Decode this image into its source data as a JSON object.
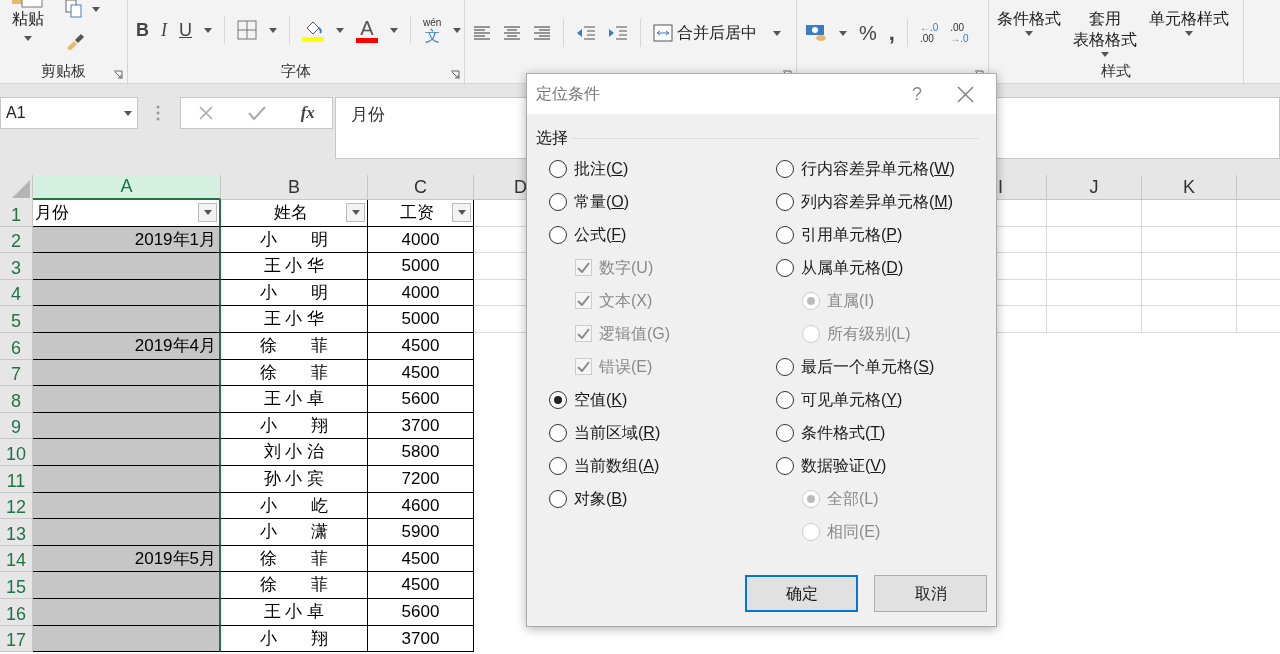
{
  "ribbon": {
    "clipboard": {
      "paste_label": "粘贴",
      "group_label": "剪贴板"
    },
    "font": {
      "bold": "B",
      "italic": "I",
      "underline": "U",
      "font_color": "A",
      "phonetic_top": "wén",
      "phonetic_main": "文",
      "group_label": "字体"
    },
    "alignment": {
      "merge_label": "合并后居中"
    },
    "number": {
      "percent": "%",
      "comma": ",",
      "increase_decimal": [
        "←.0",
        ".00"
      ],
      "decrease_decimal": [
        ".00",
        "→.0"
      ]
    },
    "styles": {
      "buttons": [
        {
          "lines": [
            "条件格式"
          ]
        },
        {
          "lines": [
            "套用",
            "表格格式"
          ]
        },
        {
          "lines": [
            "单元格样式"
          ]
        }
      ],
      "group_label": "样式"
    }
  },
  "formula_bar": {
    "name_box": "A1",
    "fx": "fx",
    "value": "月份"
  },
  "columns": [
    {
      "label": "A",
      "selected": true
    },
    {
      "label": "B",
      "selected": false
    },
    {
      "label": "C",
      "selected": false
    },
    {
      "label": "D",
      "selected": false
    },
    {
      "label": "I",
      "selected": false
    },
    {
      "label": "J",
      "selected": false
    },
    {
      "label": "K",
      "selected": false
    }
  ],
  "header_row": {
    "row": "1",
    "cells": [
      "月份",
      "姓名",
      "工资"
    ]
  },
  "rows": [
    {
      "row": "2",
      "month": "2019年1月",
      "name": "小　　明",
      "salary": "4000"
    },
    {
      "row": "3",
      "name": "王 小 华",
      "salary": "5000"
    },
    {
      "row": "4",
      "name": "小　　明",
      "salary": "4000"
    },
    {
      "row": "5",
      "name": "王 小 华",
      "salary": "5000"
    },
    {
      "row": "6",
      "month": "2019年4月",
      "name": "徐　　菲",
      "salary": "4500"
    },
    {
      "row": "7",
      "name": "徐　　菲",
      "salary": "4500"
    },
    {
      "row": "8",
      "name": "王 小 卓",
      "salary": "5600"
    },
    {
      "row": "9",
      "name": "小　　翔",
      "salary": "3700"
    },
    {
      "row": "10",
      "name": "刘 小 治",
      "salary": "5800"
    },
    {
      "row": "11",
      "name": "孙 小 宾",
      "salary": "7200"
    },
    {
      "row": "12",
      "name": "小　　屹",
      "salary": "4600"
    },
    {
      "row": "13",
      "name": "小　　潇",
      "salary": "5900"
    },
    {
      "row": "14",
      "month": "2019年5月",
      "name": "徐　　菲",
      "salary": "4500"
    },
    {
      "row": "15",
      "name": "徐　　菲",
      "salary": "4500"
    },
    {
      "row": "16",
      "name": "王 小 卓",
      "salary": "5600"
    },
    {
      "row": "17",
      "name": "小　　翔",
      "salary": "3700"
    }
  ],
  "dialog": {
    "title": "定位条件",
    "help": "?",
    "section": "选择",
    "left": [
      {
        "label": "批注(C)",
        "kind": "radio",
        "selected": false,
        "disabled": false
      },
      {
        "label": "常量(O)",
        "kind": "radio",
        "selected": false,
        "disabled": false
      },
      {
        "label": "公式(F)",
        "kind": "radio",
        "selected": false,
        "disabled": false,
        "children": [
          {
            "label": "数字(U)",
            "kind": "checkbox",
            "checked": true,
            "disabled": true
          },
          {
            "label": "文本(X)",
            "kind": "checkbox",
            "checked": true,
            "disabled": true
          },
          {
            "label": "逻辑值(G)",
            "kind": "checkbox",
            "checked": true,
            "disabled": true
          },
          {
            "label": "错误(E)",
            "kind": "checkbox",
            "checked": true,
            "disabled": true
          }
        ]
      },
      {
        "label": "空值(K)",
        "kind": "radio",
        "selected": true,
        "disabled": false
      },
      {
        "label": "当前区域(R)",
        "kind": "radio",
        "selected": false,
        "disabled": false
      },
      {
        "label": "当前数组(A)",
        "kind": "radio",
        "selected": false,
        "disabled": false
      },
      {
        "label": "对象(B)",
        "kind": "radio",
        "selected": false,
        "disabled": false
      }
    ],
    "right": [
      {
        "label": "行内容差异单元格(W)",
        "kind": "radio",
        "selected": false,
        "disabled": false
      },
      {
        "label": "列内容差异单元格(M)",
        "kind": "radio",
        "selected": false,
        "disabled": false
      },
      {
        "label": "引用单元格(P)",
        "kind": "radio",
        "selected": false,
        "disabled": false
      },
      {
        "label": "从属单元格(D)",
        "kind": "radio",
        "selected": false,
        "disabled": false,
        "children": [
          {
            "label": "直属(I)",
            "kind": "radio",
            "selected": true,
            "disabled": true
          },
          {
            "label": "所有级别(L)",
            "kind": "radio",
            "selected": false,
            "disabled": true
          }
        ]
      },
      {
        "label": "最后一个单元格(S)",
        "kind": "radio",
        "selected": false,
        "disabled": false
      },
      {
        "label": "可见单元格(Y)",
        "kind": "radio",
        "selected": false,
        "disabled": false
      },
      {
        "label": "条件格式(T)",
        "kind": "radio",
        "selected": false,
        "disabled": false
      },
      {
        "label": "数据验证(V)",
        "kind": "radio",
        "selected": false,
        "disabled": false,
        "children": [
          {
            "label": "全部(L)",
            "kind": "radio",
            "selected": true,
            "disabled": true
          },
          {
            "label": "相同(E)",
            "kind": "radio",
            "selected": false,
            "disabled": true
          }
        ]
      }
    ],
    "buttons": [
      {
        "label": "确定",
        "focused": true
      },
      {
        "label": "取消",
        "focused": false
      }
    ]
  }
}
